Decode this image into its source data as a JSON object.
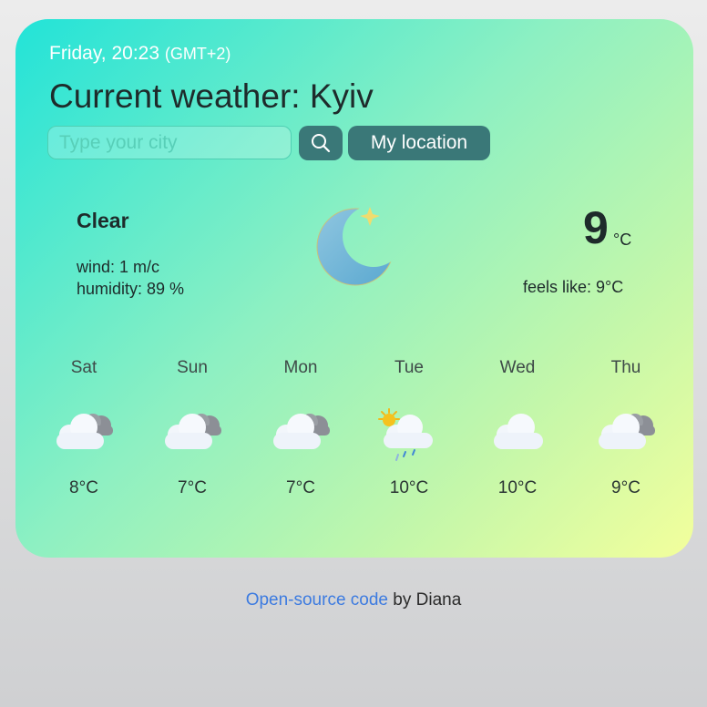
{
  "header": {
    "day_time": "Friday, 20:23",
    "timezone": "(GMT+2)",
    "title": "Current weather: Kyiv"
  },
  "search": {
    "placeholder": "Type your city",
    "value": "",
    "search_icon": "search-icon",
    "location_button_label": "My location"
  },
  "current": {
    "condition": "Clear",
    "icon": "moon-star-icon",
    "wind": "wind: 1 m/c",
    "humidity": "humidity: 89 %",
    "temperature": "9",
    "unit": "°C",
    "feels_like": "feels like: 9°C"
  },
  "forecast": [
    {
      "day": "Sat",
      "icon": "cloud-dark-cloud-icon",
      "temp": "8°C"
    },
    {
      "day": "Sun",
      "icon": "cloud-dark-cloud-icon",
      "temp": "7°C"
    },
    {
      "day": "Mon",
      "icon": "cloud-dark-cloud-icon",
      "temp": "7°C"
    },
    {
      "day": "Tue",
      "icon": "sun-cloud-rain-icon",
      "temp": "10°C"
    },
    {
      "day": "Wed",
      "icon": "cloud-icon",
      "temp": "10°C"
    },
    {
      "day": "Thu",
      "icon": "cloud-dark-cloud-icon",
      "temp": "9°C"
    }
  ],
  "footer": {
    "link_text": "Open-source code",
    "suffix": " by Diana"
  },
  "colors": {
    "gradient_start": "#22e3d8",
    "gradient_end": "#f3ff9c",
    "button": "#3a7878",
    "link": "#3d7be0"
  }
}
